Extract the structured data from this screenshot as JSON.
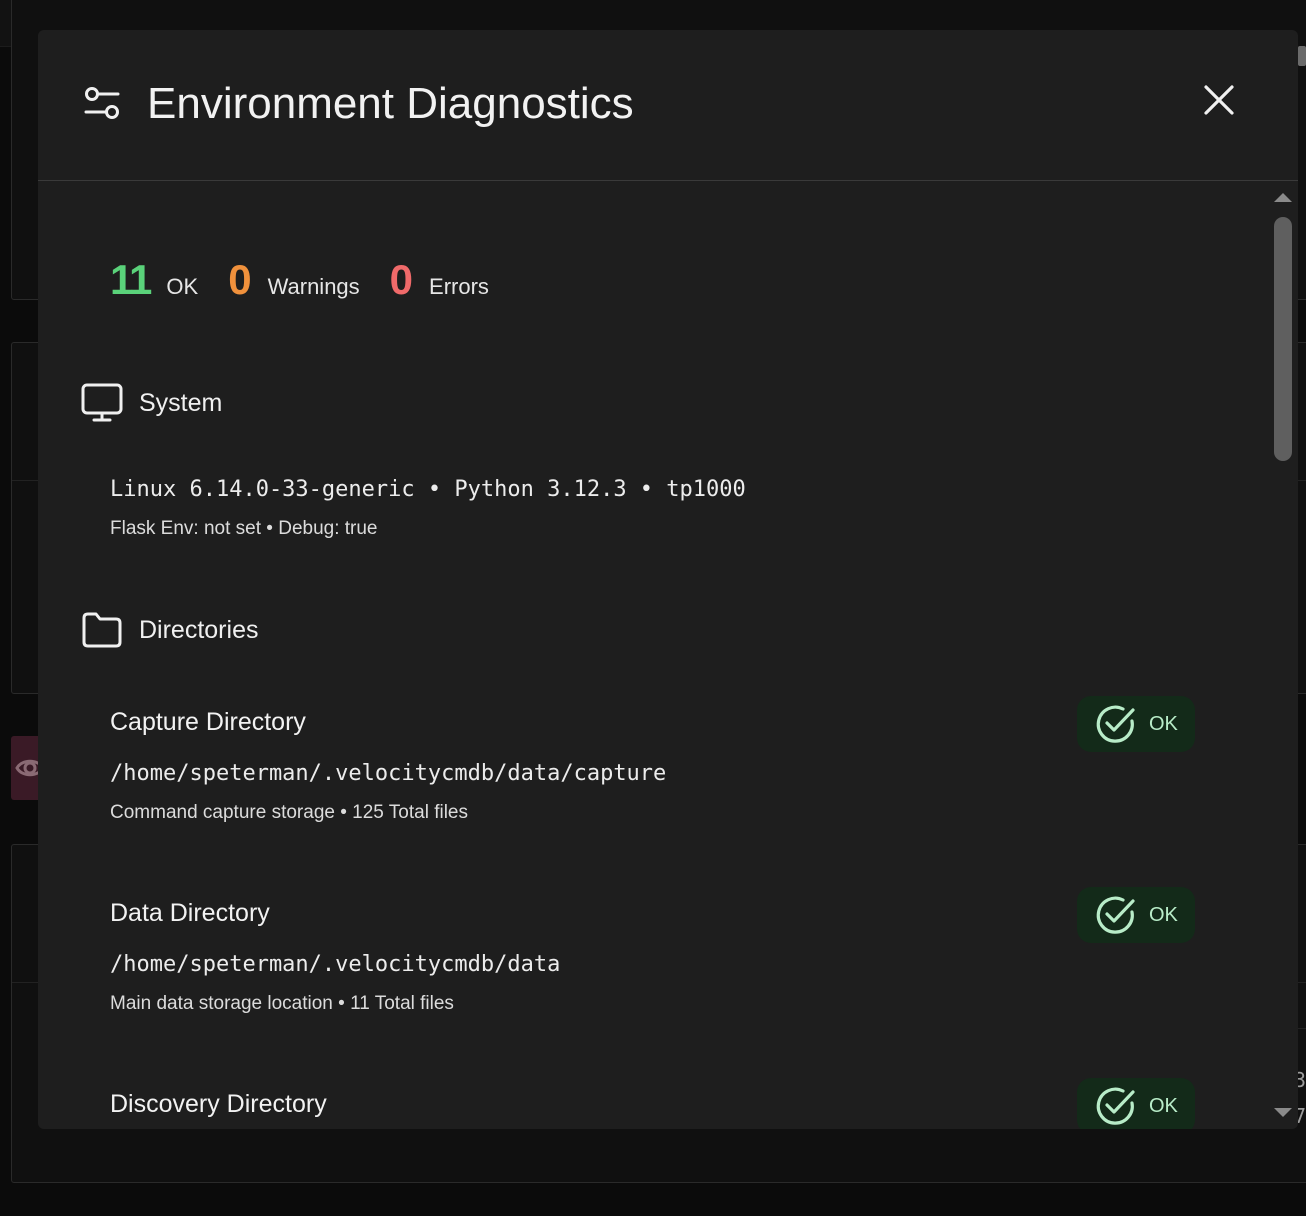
{
  "modal": {
    "title": "Environment Diagnostics"
  },
  "summary": {
    "ok_count": "11",
    "ok_label": "OK",
    "warnings_count": "0",
    "warnings_label": "Warnings",
    "errors_count": "0",
    "errors_label": "Errors"
  },
  "system": {
    "heading": "System",
    "info_line": "Linux 6.14.0-33-generic • Python 3.12.3 • tp1000",
    "env_line": "Flask Env: not set • Debug: true"
  },
  "directories": {
    "heading": "Directories",
    "items": [
      {
        "name": "Capture Directory",
        "path": "/home/speterman/.velocitycmdb/data/capture",
        "description": "Command capture storage • 125 Total files",
        "status": "OK"
      },
      {
        "name": "Data Directory",
        "path": "/home/speterman/.velocitycmdb/data",
        "description": "Main data storage location • 11 Total files",
        "status": "OK"
      },
      {
        "name": "Discovery Directory",
        "status": "OK"
      }
    ]
  },
  "background": {
    "edge_text_1": "3",
    "edge_text_2": "7"
  },
  "colors": {
    "ok": "#5ad27a",
    "warning": "#f0913c",
    "error": "#f06a6a",
    "badge_bg": "#132a19"
  },
  "icons": {
    "header": "sliders-icon",
    "system": "monitor-icon",
    "directories": "folder-icon",
    "status": "check-circle-icon",
    "close": "close-icon"
  }
}
